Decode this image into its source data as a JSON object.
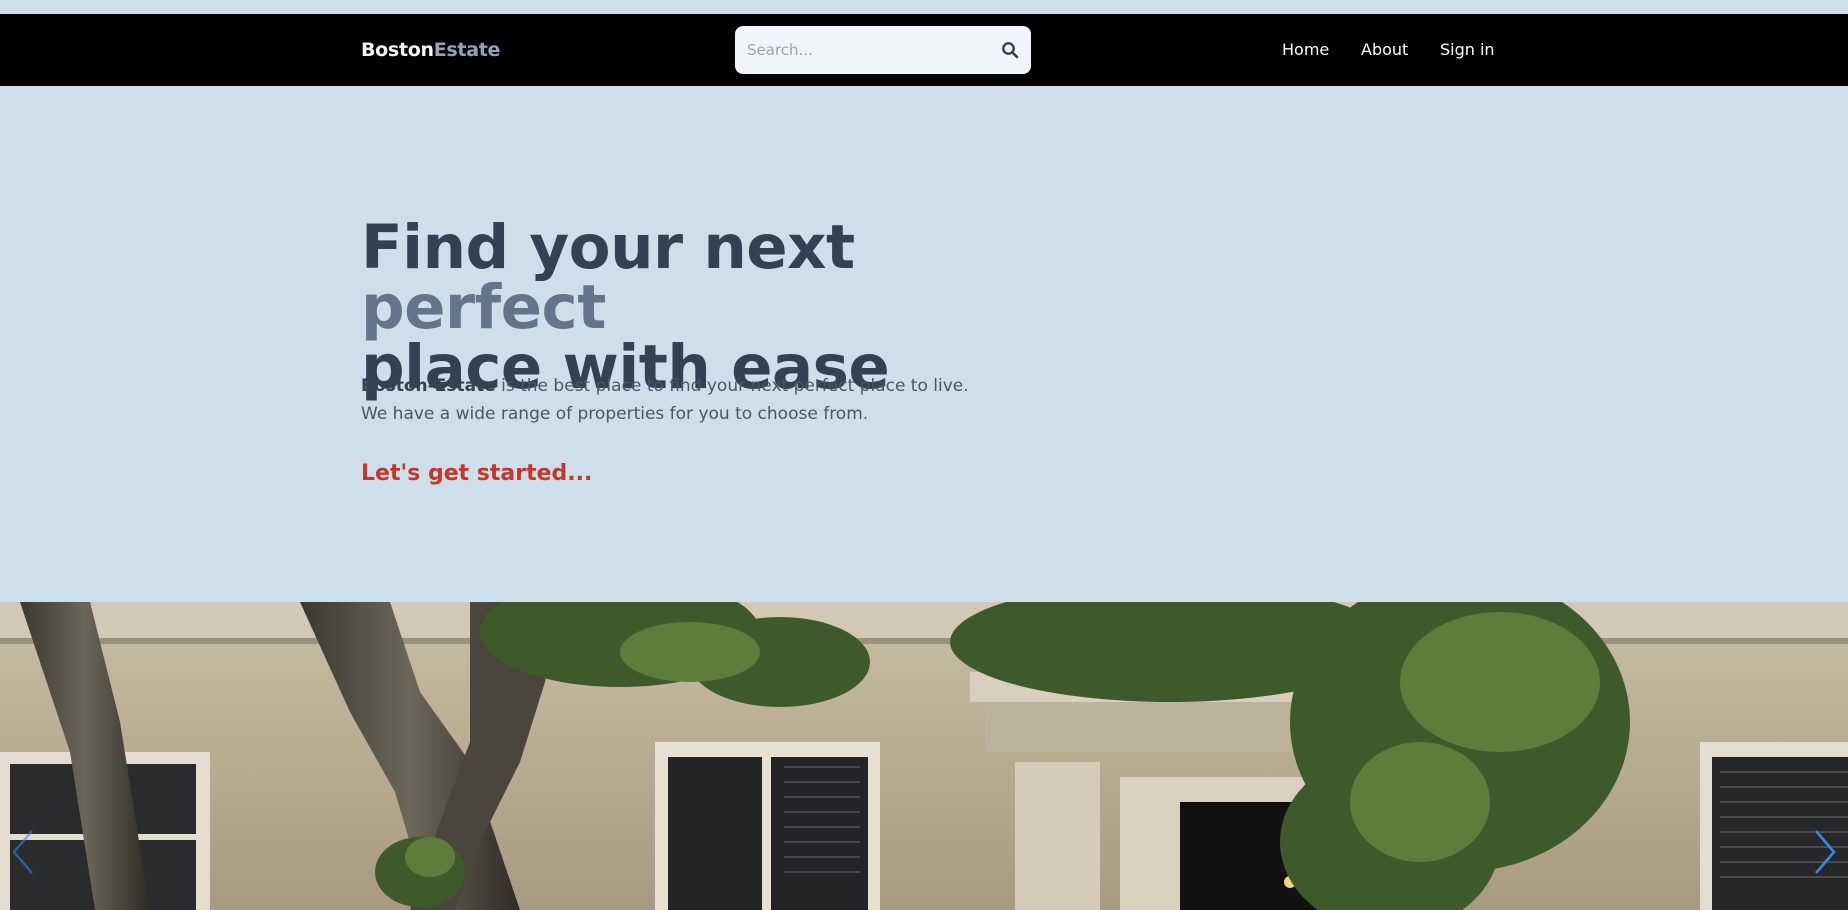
{
  "brand": {
    "part1": "Boston",
    "part2": "Estate"
  },
  "search": {
    "placeholder": "Search...",
    "value": ""
  },
  "nav": {
    "items": [
      "Home",
      "About",
      "Sign in"
    ]
  },
  "hero": {
    "title_part1": "Find your next ",
    "title_accent": "perfect",
    "title_part2": "place with ease",
    "desc_strong": "Boston-Estate",
    "desc_rest": " is the best place to find your next perfect place to live.",
    "desc_line2": "We have a wide range of properties for you to choose from.",
    "cta": "Let's get started..."
  },
  "colors": {
    "background": "#cfdeeb",
    "navbar": "#000000",
    "heading": "#334155",
    "accent": "#64748b",
    "cta": "#c0392b",
    "carousel_arrow": "#3b82f6"
  },
  "icons": {
    "search": "search-icon",
    "prev": "chevron-left-icon",
    "next": "chevron-right-icon"
  }
}
